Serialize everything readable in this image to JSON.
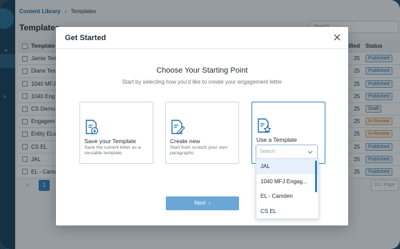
{
  "breadcrumb": {
    "root": "Content Library",
    "current": "Templates"
  },
  "page": {
    "title": "Templates",
    "search_placeholder": "Search"
  },
  "table": {
    "headers": {
      "name": "Template",
      "modified": "Modified",
      "status": "Status"
    },
    "rows": [
      {
        "name": "Jamie Ten",
        "modified": "25",
        "status": "Published",
        "status_kind": "published"
      },
      {
        "name": "Diane Tes",
        "modified": "25",
        "status": "Published",
        "status_kind": "published"
      },
      {
        "name": "1040 MFJ",
        "modified": "25",
        "status": "Published",
        "status_kind": "published"
      },
      {
        "name": "1040 Eng",
        "modified": "25",
        "status": "Published",
        "status_kind": "published"
      },
      {
        "name": "CS Demo",
        "modified": "25",
        "status": "Draft",
        "status_kind": "draft"
      },
      {
        "name": "Engagem",
        "modified": "25",
        "status": "In Review",
        "status_kind": "review"
      },
      {
        "name": "Entity ELs",
        "modified": "25",
        "status": "In Review",
        "status_kind": "review"
      },
      {
        "name": "CS EL",
        "modified": "25",
        "status": "Published",
        "status_kind": "published"
      },
      {
        "name": "JAL",
        "modified": "25",
        "status": "Published",
        "status_kind": "published"
      },
      {
        "name": "EL - Camde",
        "modified": "25",
        "status": "Published",
        "status_kind": "published"
      }
    ]
  },
  "pager": {
    "prev": "<",
    "current_page": "1",
    "per_page": "10 / Page"
  },
  "modal": {
    "title": "Get Started",
    "heading": "Choose Your Starting Point",
    "subheading": "Start by selecting how you'd like to create your engagement letter",
    "cards": [
      {
        "title": "Save your Template",
        "description": "Save the current letter as a reusable template",
        "icon": "document-download-icon"
      },
      {
        "title": "Create new",
        "description": "Start from scratch your own paragraphs",
        "icon": "document-edit-icon"
      },
      {
        "title": "Use a Template",
        "description": "",
        "icon": "document-star-icon"
      }
    ],
    "template_select": {
      "placeholder": "Search"
    },
    "dropdown_options": [
      "JAL",
      "1040 MFJ Engag...",
      "EL - Camden",
      "CS EL"
    ],
    "next_label": "Next",
    "colors": {
      "primary": "#2f80c0",
      "next_button": "#6aa6d6"
    }
  }
}
